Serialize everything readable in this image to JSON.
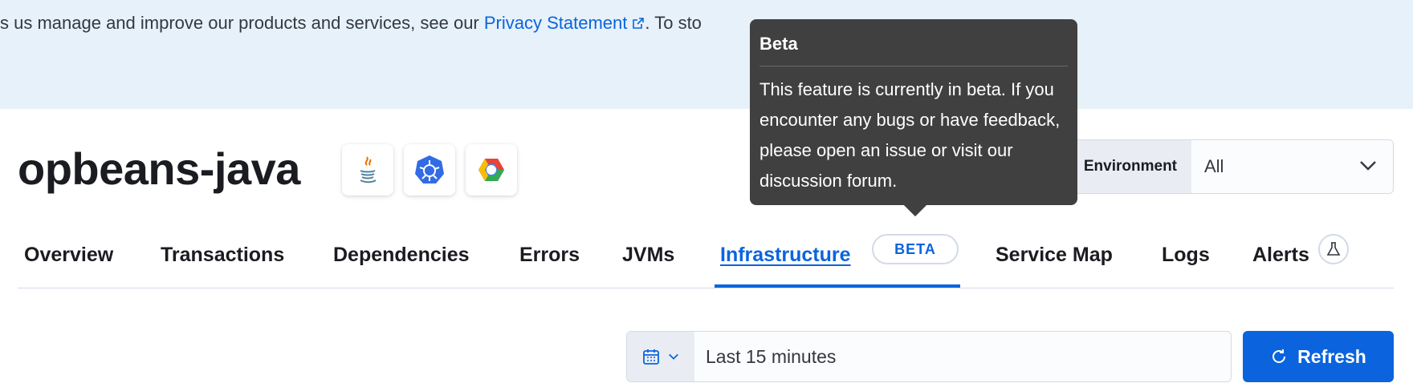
{
  "banner": {
    "text_before": "s us manage and improve our products and services, see our ",
    "link_label": "Privacy Statement",
    "text_after": ". To sto"
  },
  "header": {
    "title": "opbeans-java",
    "badges": [
      {
        "icon": "java-icon"
      },
      {
        "icon": "kubernetes-icon"
      },
      {
        "icon": "gcp-icon"
      }
    ]
  },
  "environment": {
    "label": "Environment",
    "value": "All"
  },
  "tabs": [
    {
      "label": "Overview"
    },
    {
      "label": "Transactions"
    },
    {
      "label": "Dependencies"
    },
    {
      "label": "Errors"
    },
    {
      "label": "JVMs"
    },
    {
      "label": "Infrastructure",
      "active": true,
      "badge": "BETA"
    },
    {
      "label": "Service Map"
    },
    {
      "label": "Logs"
    },
    {
      "label": "Alerts",
      "icon": "beaker-icon"
    }
  ],
  "datepicker": {
    "value": "Last 15 minutes"
  },
  "refresh": {
    "label": "Refresh"
  },
  "tooltip": {
    "title": "Beta",
    "body": "This feature is currently in beta. If you encounter any bugs or have feedback, please open an issue or visit our discussion forum."
  },
  "colors": {
    "accent": "#0b64dd",
    "banner_bg": "#e6f1fa",
    "tooltip_bg": "#404040"
  }
}
